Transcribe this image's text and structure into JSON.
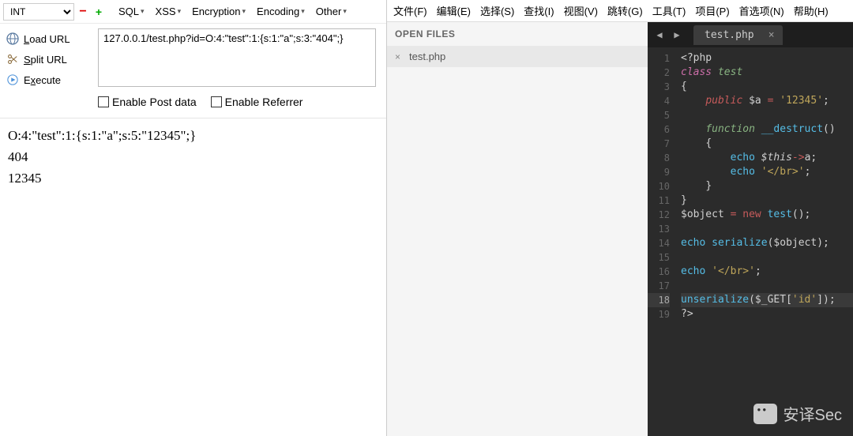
{
  "hackbar": {
    "dropdown": "INT",
    "menu": [
      "SQL",
      "XSS",
      "Encryption",
      "Encoding",
      "Other"
    ],
    "sidebar": [
      {
        "label": "Load URL",
        "icon": "globe"
      },
      {
        "label": "Split URL",
        "icon": "scissors"
      },
      {
        "label": "Execute",
        "icon": "play"
      }
    ],
    "url_value": "127.0.0.1/test.php?id=O:4:\"test\":1:{s:1:\"a\";s:3:\"404\";}",
    "enable_post": "Enable Post data",
    "enable_referrer": "Enable Referrer",
    "output": [
      "O:4:\"test\":1:{s:1:\"a\";s:5:\"12345\";}",
      "404",
      "12345"
    ]
  },
  "sublime": {
    "menubar": [
      "文件(F)",
      "编辑(E)",
      "选择(S)",
      "查找(I)",
      "视图(V)",
      "跳转(G)",
      "工具(T)",
      "项目(P)",
      "首选项(N)",
      "帮助(H)"
    ],
    "open_files_label": "OPEN FILES",
    "open_files": [
      "test.php"
    ],
    "tab": "test.php",
    "code": {
      "lines": [
        {
          "n": 1,
          "html": "<span class='c-tag'>&lt;?php</span>"
        },
        {
          "n": 2,
          "html": "<span class='c-kw'>class</span> <span class='c-cls'>test</span>"
        },
        {
          "n": 3,
          "html": "<span class='c-br'>{</span>"
        },
        {
          "n": 4,
          "html": "    <span class='c-pub'>public</span> <span class='c-var'>$a</span> <span class='c-op'>=</span> <span class='c-str'>'12345'</span><span class='c-punc'>;</span>"
        },
        {
          "n": 5,
          "html": ""
        },
        {
          "n": 6,
          "html": "    <span class='c-fn'>function</span> <span class='c-fnname'>__destruct</span><span class='c-punc'>()</span>"
        },
        {
          "n": 7,
          "html": "    <span class='c-br'>{</span>"
        },
        {
          "n": 8,
          "html": "        <span class='c-call'>echo</span> <span class='c-this'>$this</span><span class='c-op'>-&gt;</span><span class='c-var'>a</span><span class='c-punc'>;</span>"
        },
        {
          "n": 9,
          "html": "        <span class='c-call'>echo</span> <span class='c-str'>'&lt;/br&gt;'</span><span class='c-punc'>;</span>"
        },
        {
          "n": 10,
          "html": "    <span class='c-br'>}</span>"
        },
        {
          "n": 11,
          "html": "<span class='c-br'>}</span>"
        },
        {
          "n": 12,
          "html": "<span class='c-var'>$object</span> <span class='c-op'>=</span> <span class='c-op'>new</span> <span class='c-call'>test</span><span class='c-punc'>();</span>"
        },
        {
          "n": 13,
          "html": ""
        },
        {
          "n": 14,
          "html": "<span class='c-call'>echo</span> <span class='c-call'>serialize</span><span class='c-punc'>(</span><span class='c-var'>$object</span><span class='c-punc'>);</span>"
        },
        {
          "n": 15,
          "html": ""
        },
        {
          "n": 16,
          "html": "<span class='c-call'>echo</span> <span class='c-str'>'&lt;/br&gt;'</span><span class='c-punc'>;</span>"
        },
        {
          "n": 17,
          "html": ""
        },
        {
          "n": 18,
          "html": "<span class='c-call'>unserialize</span><span class='c-punc'>(</span><span class='c-var'>$_GET</span><span class='c-punc'>[</span><span class='c-str'>'id'</span><span class='c-punc'>]);</span>",
          "active": true
        },
        {
          "n": 19,
          "html": "<span class='c-tag'>?&gt;</span>"
        }
      ]
    }
  },
  "watermark": "安译Sec"
}
